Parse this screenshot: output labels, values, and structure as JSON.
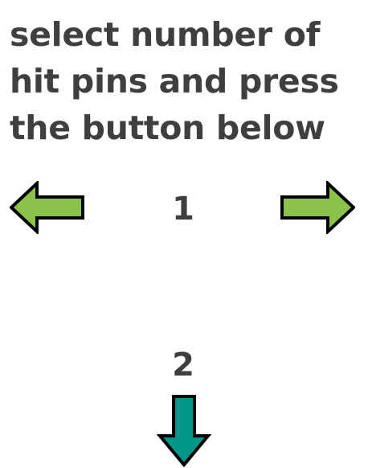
{
  "instruction": {
    "line1": "select number of",
    "line2": "hit pins and press",
    "line3": "the button below"
  },
  "selector": {
    "current_value": "1",
    "left_arrow_icon": "arrow-left-icon",
    "right_arrow_icon": "arrow-right-icon",
    "arrow_color": "#8BC34A"
  },
  "submit": {
    "value": "2",
    "down_arrow_icon": "arrow-down-icon",
    "arrow_color": "#009688"
  }
}
